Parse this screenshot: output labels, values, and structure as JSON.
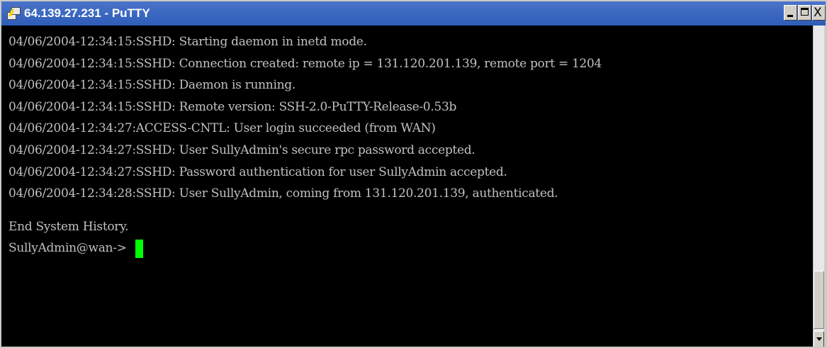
{
  "window": {
    "title": "64.139.27.231 - PuTTY",
    "app_icon": "putty-icon",
    "controls": {
      "minimize_icon": "minimize-icon",
      "maximize_icon": "maximize-icon",
      "close_icon": "close-icon",
      "close_glyph": "X"
    }
  },
  "terminal": {
    "background": "#000000",
    "text_color": "#c0c0c0",
    "cursor_color": "#00ff00",
    "lines": [
      "04/06/2004-12:34:15:SSHD: Starting daemon in inetd mode.",
      "04/06/2004-12:34:15:SSHD: Connection created: remote ip = 131.120.201.139, remote port = 1204",
      "04/06/2004-12:34:15:SSHD: Daemon is running.",
      "04/06/2004-12:34:15:SSHD: Remote version: SSH-2.0-PuTTY-Release-0.53b",
      "04/06/2004-12:34:27:ACCESS-CNTL: User login succeeded (from WAN)",
      "04/06/2004-12:34:27:SSHD: User SullyAdmin's secure rpc password accepted.",
      "04/06/2004-12:34:27:SSHD: Password authentication for user SullyAdmin accepted.",
      "04/06/2004-12:34:28:SSHD: User SullyAdmin, coming from 131.120.201.139, authenticated."
    ],
    "footer": "End System History.",
    "prompt": "SullyAdmin@wan->"
  }
}
